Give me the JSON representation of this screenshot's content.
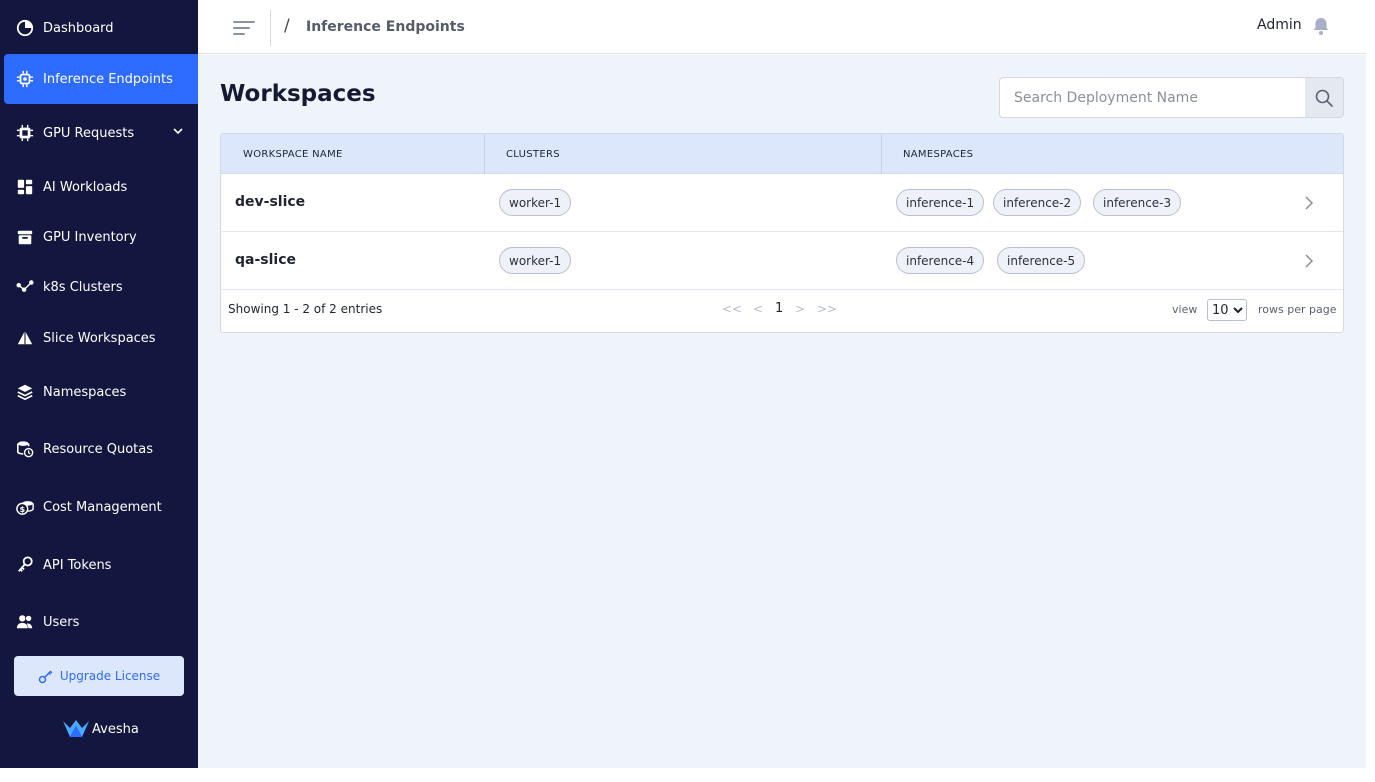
{
  "sidebar": {
    "items": [
      {
        "label": "Dashboard",
        "icon": "pie-chart-icon"
      },
      {
        "label": "Inference Endpoints",
        "icon": "chip-gear-icon",
        "active": true
      },
      {
        "label": "GPU Requests",
        "icon": "cpu-icon",
        "expandable": true
      },
      {
        "label": "AI Workloads",
        "icon": "grid-icon"
      },
      {
        "label": "GPU Inventory",
        "icon": "archive-box-icon"
      },
      {
        "label": "k8s Clusters",
        "icon": "nodes-icon"
      },
      {
        "label": "Slice Workspaces",
        "icon": "pyramid-icon"
      },
      {
        "label": "Namespaces",
        "icon": "layers-icon"
      },
      {
        "label": "Resource Quotas",
        "icon": "database-clock-icon"
      },
      {
        "label": "Cost Management",
        "icon": "dollar-coins-icon"
      },
      {
        "label": "API Tokens",
        "icon": "key-icon"
      },
      {
        "label": "Users",
        "icon": "users-icon"
      }
    ],
    "upgrade_label": "Upgrade License",
    "brand": "Avesha"
  },
  "header": {
    "breadcrumb_sep": "/",
    "breadcrumb": "Inference Endpoints",
    "user": "Admin"
  },
  "main": {
    "title": "Workspaces",
    "search": {
      "placeholder": "Search Deployment Name",
      "value": ""
    },
    "table": {
      "columns": [
        "WORKSPACE NAME",
        "CLUSTERS",
        "NAMESPACES"
      ],
      "rows": [
        {
          "name": "dev-slice",
          "clusters": [
            "worker-1"
          ],
          "namespaces": [
            "inference-1",
            "inference-2",
            "inference-3"
          ]
        },
        {
          "name": "qa-slice",
          "clusters": [
            "worker-1"
          ],
          "namespaces": [
            "inference-4",
            "inference-5"
          ]
        }
      ]
    },
    "footer": {
      "showing": "Showing 1 - 2 of 2 entries",
      "first": "<<",
      "prev": "<",
      "page": "1",
      "next": ">",
      "last": ">>",
      "view_label": "view",
      "rows_per_page": "10",
      "rows_per_page_label": "rows per page"
    }
  },
  "colors": {
    "sidebar_bg": "#13163f",
    "accent": "#2e6bff",
    "main_bg": "#eff3fa",
    "table_header_bg": "#dce7fb"
  }
}
